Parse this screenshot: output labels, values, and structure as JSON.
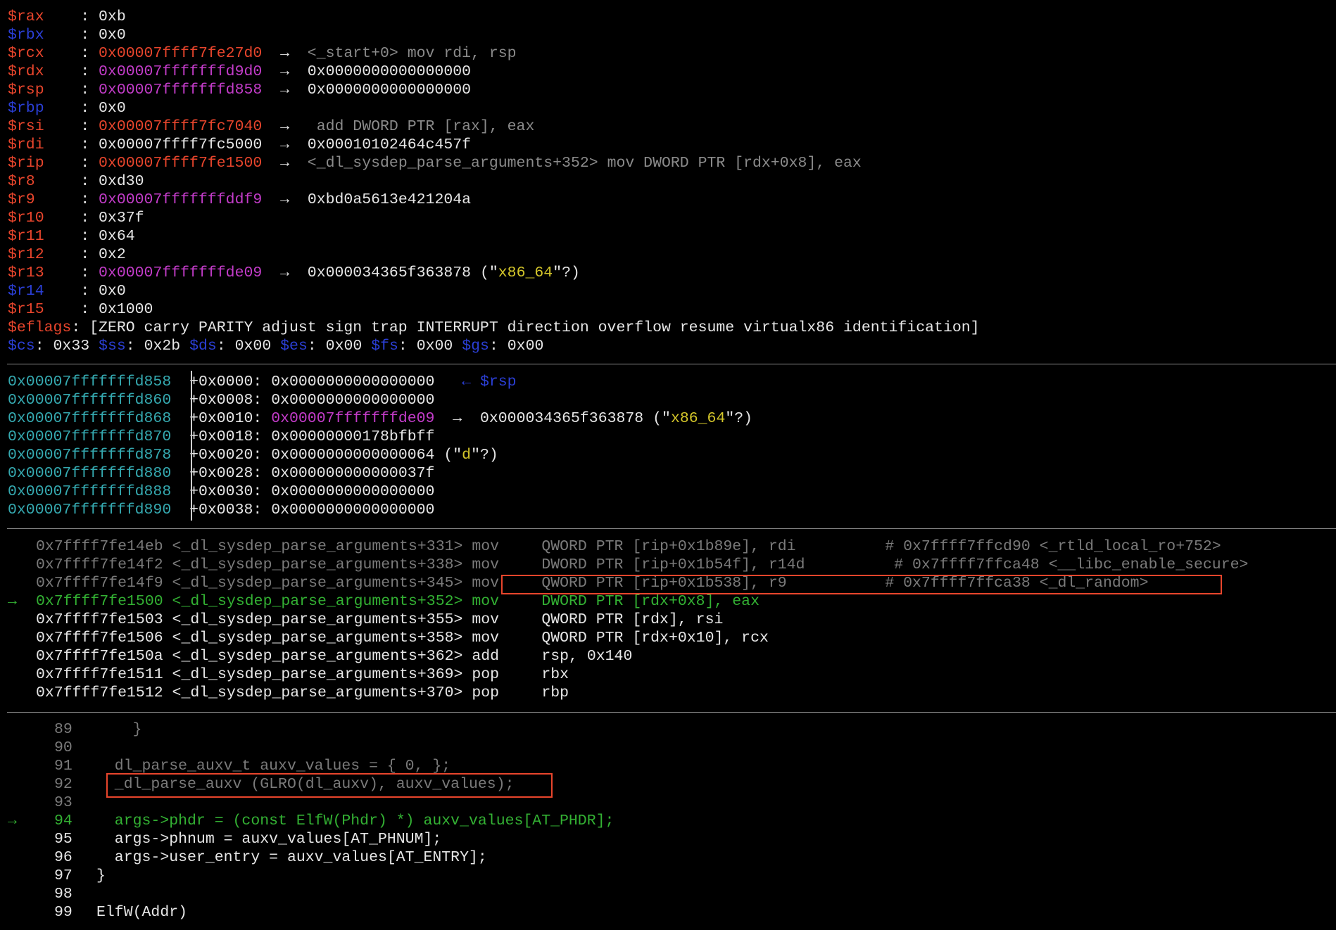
{
  "registers": [
    {
      "name": "$rax",
      "value": "0xb",
      "color": "red",
      "vcolor": "white"
    },
    {
      "name": "$rbx",
      "value": "0x0",
      "color": "blue",
      "vcolor": "white"
    },
    {
      "name": "$rcx",
      "value": "0x00007ffff7fe27d0",
      "color": "red",
      "vcolor": "red",
      "deref": "<_start+0> mov rdi, rsp",
      "dcolor": "grey"
    },
    {
      "name": "$rdx",
      "value": "0x00007fffffffd9d0",
      "color": "red",
      "vcolor": "mag",
      "deref": "0x0000000000000000",
      "dcolor": "white"
    },
    {
      "name": "$rsp",
      "value": "0x00007fffffffd858",
      "color": "red",
      "vcolor": "mag",
      "deref": "0x0000000000000000",
      "dcolor": "white"
    },
    {
      "name": "$rbp",
      "value": "0x0",
      "color": "blue",
      "vcolor": "white"
    },
    {
      "name": "$rsi",
      "value": "0x00007ffff7fc7040",
      "color": "red",
      "vcolor": "red",
      "deref": " add DWORD PTR [rax], eax",
      "dcolor": "grey"
    },
    {
      "name": "$rdi",
      "value": "0x00007ffff7fc5000",
      "color": "red",
      "vcolor": "white",
      "deref": "0x00010102464c457f",
      "dcolor": "white"
    },
    {
      "name": "$rip",
      "value": "0x00007ffff7fe1500",
      "color": "red",
      "vcolor": "red",
      "deref": "<_dl_sysdep_parse_arguments+352> mov DWORD PTR [rdx+0x8], eax",
      "dcolor": "grey"
    },
    {
      "name": "$r8",
      "value": "0xd30",
      "color": "red",
      "vcolor": "white"
    },
    {
      "name": "$r9",
      "value": "0x00007fffffffddf9",
      "color": "red",
      "vcolor": "mag",
      "deref": "0xbd0a5613e421204a",
      "dcolor": "white"
    },
    {
      "name": "$r10",
      "value": "0x37f",
      "color": "red",
      "vcolor": "white"
    },
    {
      "name": "$r11",
      "value": "0x64",
      "color": "red",
      "vcolor": "white"
    },
    {
      "name": "$r12",
      "value": "0x2",
      "color": "red",
      "vcolor": "white"
    },
    {
      "name": "$r13",
      "value": "0x00007fffffffde09",
      "color": "red",
      "vcolor": "mag",
      "deref": "0x000034365f363878",
      "dcolor": "white",
      "str_pre": " (\"",
      "str": "x86_64",
      "str_post": "\"?)"
    },
    {
      "name": "$r14",
      "value": "0x0",
      "color": "blue",
      "vcolor": "white"
    },
    {
      "name": "$r15",
      "value": "0x1000",
      "color": "red",
      "vcolor": "white"
    }
  ],
  "eflags": {
    "label": "$eflags",
    "value": "[ZERO carry PARITY adjust sign trap INTERRUPT direction overflow resume virtualx86 identification]"
  },
  "segments": [
    {
      "name": "$cs",
      "value": "0x33"
    },
    {
      "name": "$ss",
      "value": "0x2b"
    },
    {
      "name": "$ds",
      "value": "0x00"
    },
    {
      "name": "$es",
      "value": "0x00"
    },
    {
      "name": "$fs",
      "value": "0x00"
    },
    {
      "name": "$gs",
      "value": "0x00"
    }
  ],
  "stack": [
    {
      "addr": "0x00007fffffffd858",
      "off": "+0x0000:",
      "val": "0x0000000000000000",
      "vcolor": "white",
      "extra": "  ← $rsp",
      "ecolor": "blue"
    },
    {
      "addr": "0x00007fffffffd860",
      "off": "+0x0008:",
      "val": "0x0000000000000000",
      "vcolor": "white"
    },
    {
      "addr": "0x00007fffffffd868",
      "off": "+0x0010:",
      "val": "0x00007fffffffde09",
      "vcolor": "mag",
      "arrow": "→",
      "deref": "0x000034365f363878",
      "str": "x86_64"
    },
    {
      "addr": "0x00007fffffffd870",
      "off": "+0x0018:",
      "val": "0x00000000178bfbff",
      "vcolor": "white"
    },
    {
      "addr": "0x00007fffffffd878",
      "off": "+0x0020:",
      "val": "0x0000000000000064",
      "vcolor": "white",
      "str": "d"
    },
    {
      "addr": "0x00007fffffffd880",
      "off": "+0x0028:",
      "val": "0x000000000000037f",
      "vcolor": "white"
    },
    {
      "addr": "0x00007fffffffd888",
      "off": "+0x0030:",
      "val": "0x0000000000000000",
      "vcolor": "white"
    },
    {
      "addr": "0x00007fffffffd890",
      "off": "+0x0038:",
      "val": "0x0000000000000000",
      "vcolor": "white"
    }
  ],
  "disasm": [
    {
      "marker": "",
      "addr": "0x7ffff7fe14eb",
      "sym": "<_dl_sysdep_parse_arguments+331>",
      "op": "mov",
      "args": "QWORD PTR [rip+0x1b89e], rdi",
      "comment": "# 0x7ffff7ffcd90 <_rtld_local_ro+752>",
      "state": "past"
    },
    {
      "marker": "",
      "addr": "0x7ffff7fe14f2",
      "sym": "<_dl_sysdep_parse_arguments+338>",
      "op": "mov",
      "args": "DWORD PTR [rip+0x1b54f], r14d",
      "comment": " # 0x7ffff7ffca48 <__libc_enable_secure>",
      "state": "past"
    },
    {
      "marker": "",
      "addr": "0x7ffff7fe14f9",
      "sym": "<_dl_sysdep_parse_arguments+345>",
      "op": "mov",
      "args": "QWORD PTR [rip+0x1b538], r9",
      "comment": "# 0x7ffff7ffca38 <_dl_random>",
      "state": "past"
    },
    {
      "marker": "→",
      "addr": "0x7ffff7fe1500",
      "sym": "<_dl_sysdep_parse_arguments+352>",
      "op": "mov",
      "args": "DWORD PTR [rdx+0x8], eax",
      "comment": "",
      "state": "current"
    },
    {
      "marker": "",
      "addr": "0x7ffff7fe1503",
      "sym": "<_dl_sysdep_parse_arguments+355>",
      "op": "mov",
      "args": "QWORD PTR [rdx], rsi",
      "comment": "",
      "state": "future"
    },
    {
      "marker": "",
      "addr": "0x7ffff7fe1506",
      "sym": "<_dl_sysdep_parse_arguments+358>",
      "op": "mov",
      "args": "QWORD PTR [rdx+0x10], rcx",
      "comment": "",
      "state": "future"
    },
    {
      "marker": "",
      "addr": "0x7ffff7fe150a",
      "sym": "<_dl_sysdep_parse_arguments+362>",
      "op": "add",
      "args": "rsp, 0x140",
      "comment": "",
      "state": "future"
    },
    {
      "marker": "",
      "addr": "0x7ffff7fe1511",
      "sym": "<_dl_sysdep_parse_arguments+369>",
      "op": "pop",
      "args": "rbx",
      "comment": "",
      "state": "future"
    },
    {
      "marker": "",
      "addr": "0x7ffff7fe1512",
      "sym": "<_dl_sysdep_parse_arguments+370>",
      "op": "pop",
      "args": "rbp",
      "comment": "",
      "state": "future"
    }
  ],
  "source": [
    {
      "marker": "",
      "num": "89",
      "code": "    }",
      "state": "past"
    },
    {
      "marker": "",
      "num": "90",
      "code": "",
      "state": "past"
    },
    {
      "marker": "",
      "num": "91",
      "code": "  dl_parse_auxv_t auxv_values = { 0, };",
      "state": "past"
    },
    {
      "marker": "",
      "num": "92",
      "code": "  _dl_parse_auxv (GLRO(dl_auxv), auxv_values);",
      "state": "past"
    },
    {
      "marker": "",
      "num": "93",
      "code": "",
      "state": "past"
    },
    {
      "marker": "→",
      "num": "94",
      "code": "  args->phdr = (const ElfW(Phdr) *) auxv_values[AT_PHDR];",
      "state": "current"
    },
    {
      "marker": "",
      "num": "95",
      "code": "  args->phnum = auxv_values[AT_PHNUM];",
      "state": "future"
    },
    {
      "marker": "",
      "num": "96",
      "code": "  args->user_entry = auxv_values[AT_ENTRY];",
      "state": "future"
    },
    {
      "marker": "",
      "num": "97",
      "code": "}",
      "state": "future"
    },
    {
      "marker": "",
      "num": "98",
      "code": "",
      "state": "future"
    },
    {
      "marker": "",
      "num": "99",
      "code": "ElfW(Addr)",
      "state": "future"
    }
  ],
  "colors": {
    "background": "#000000",
    "register_name": "#e8452c",
    "register_unchanged": "#2b3fd6",
    "heap_pointer": "#c33cc9",
    "stack_address": "#35a9b0",
    "current_line": "#33b133",
    "string": "#d4c62a",
    "highlight_box": "#e8452c"
  }
}
